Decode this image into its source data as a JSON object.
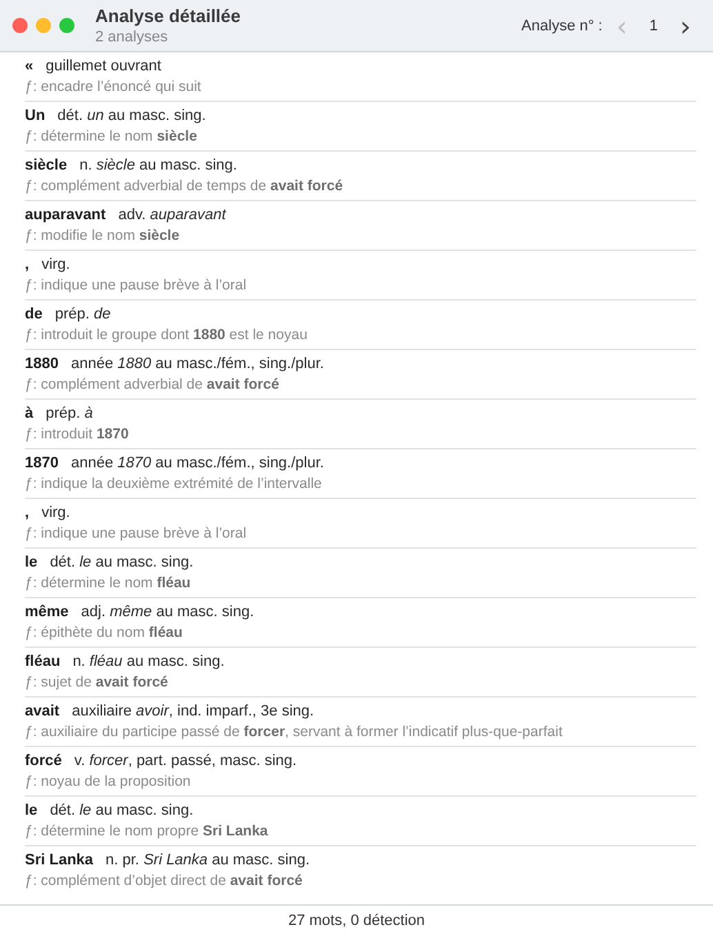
{
  "window": {
    "title": "Analyse détaillée",
    "subtitle": "2 analyses"
  },
  "navigation": {
    "label": "Analyse n° :",
    "previous": {
      "symbol": "‹",
      "disabled": true
    },
    "value": "1",
    "next": {
      "symbol": "›",
      "disabled": false
    }
  },
  "entries": [
    {
      "word": "«",
      "description": "guillemet ouvrant",
      "function": "ƒ: encadre l’énoncé qui suit"
    },
    {
      "word": "Un",
      "description": "dét. *un* au masc. sing.",
      "function": "ƒ: détermine le nom **siècle**"
    },
    {
      "word": "siècle",
      "description": "n. *siècle* au masc. sing.",
      "function": "ƒ: complément adverbial de temps de **avait forcé**"
    },
    {
      "word": "auparavant",
      "description": "adv. *auparavant*",
      "function": "ƒ: modifie le nom **siècle**"
    },
    {
      "word": ",",
      "description": "virg.",
      "function": "ƒ: indique une pause brève à l’oral"
    },
    {
      "word": "de",
      "description": "prép. *de*",
      "function": "ƒ: introduit le groupe dont **1880** est le noyau"
    },
    {
      "word": "1880",
      "description": "année *1880* au masc./fém., sing./plur.",
      "function": "ƒ: complément adverbial de **avait forcé**"
    },
    {
      "word": "à",
      "description": "prép. *à*",
      "function": "ƒ: introduit **1870**"
    },
    {
      "word": "1870",
      "description": "année *1870* au masc./fém., sing./plur.",
      "function": "ƒ: indique la deuxième extrémité de l’intervalle"
    },
    {
      "word": ",",
      "description": "virg.",
      "function": "ƒ: indique une pause brève à l’oral"
    },
    {
      "word": "le",
      "description": "dét. *le* au masc. sing.",
      "function": "ƒ: détermine le nom **fléau**"
    },
    {
      "word": "même",
      "description": "adj. *même* au masc. sing.",
      "function": "ƒ: épithète du nom **fléau**"
    },
    {
      "word": "fléau",
      "description": "n. *fléau* au masc. sing.",
      "function": "ƒ: sujet de **avait forcé**"
    },
    {
      "word": "avait",
      "description": "auxiliaire *avoir*, ind. imparf., 3e sing.",
      "function": "ƒ: auxiliaire du participe passé de **forcer**, servant à former l’indicatif plus-que-parfait"
    },
    {
      "word": "forcé",
      "description": "v. *forcer*, part. passé, masc. sing.",
      "function": "ƒ: noyau de la proposition"
    },
    {
      "word": "le",
      "description": "dét. *le* au masc. sing.",
      "function": "ƒ: détermine le nom propre **Sri Lanka**"
    },
    {
      "word": "Sri Lanka",
      "description": "n. pr. *Sri Lanka* au masc. sing.",
      "function": "ƒ: complément d’objet direct de **avait forcé**"
    }
  ],
  "status_bar": "27 mots, 0 détection"
}
